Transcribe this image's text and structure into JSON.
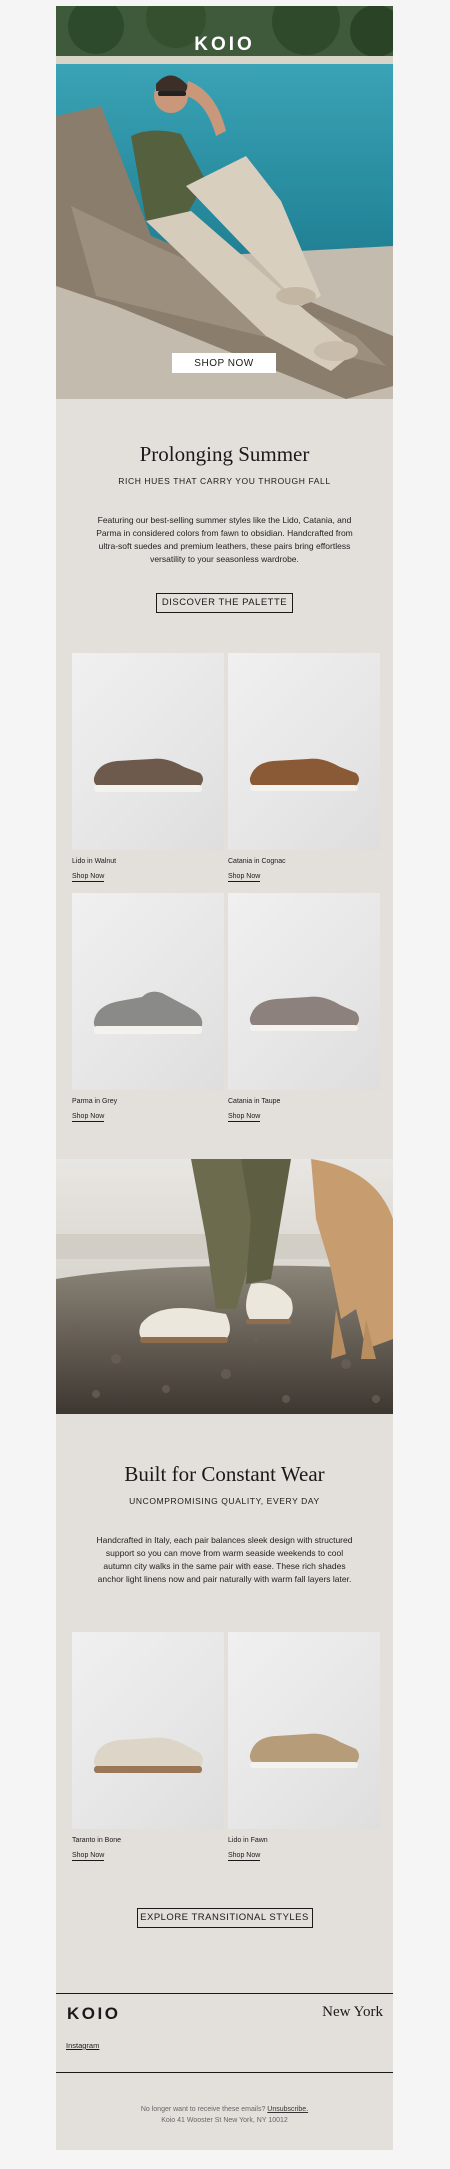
{
  "brand": "KOIO",
  "hero": {
    "cta_label": "SHOP NOW"
  },
  "section1": {
    "title": "Prolonging Summer",
    "subtitle": "RICH HUES THAT CARRY YOU THROUGH FALL",
    "body": "Featuring our best-selling summer styles like the Lido, Catania, and Parma in considered colors from fawn to obsidian. Handcrafted from ultra-soft suedes and premium leathers, these pairs bring effortless versatility to your seasonless wardrobe.",
    "cta_label": "DISCOVER THE PALETTE"
  },
  "products1": [
    {
      "name": "Lido in Walnut",
      "link": "Shop Now",
      "color": "#6e5a4c"
    },
    {
      "name": "Catania in Cognac",
      "link": "Shop Now",
      "color": "#8a5a36"
    },
    {
      "name": "Parma in Grey",
      "link": "Shop Now",
      "color": "#8a8a88"
    },
    {
      "name": "Catania in Taupe",
      "link": "Shop Now",
      "color": "#8c817d"
    }
  ],
  "section2": {
    "title": "Built for Constant Wear",
    "subtitle": "UNCOMPROMISING QUALITY, EVERY DAY",
    "body": "Handcrafted in Italy, each pair balances sleek design with structured support so you can move from warm seaside weekends to cool autumn city walks in the same pair with ease. These rich shades anchor light linens now and pair naturally with warm fall layers later.",
    "cta_label": "EXPLORE TRANSITIONAL STYLES"
  },
  "products2": [
    {
      "name": "Taranto in Bone",
      "link": "Shop Now",
      "color": "#ddd6c8"
    },
    {
      "name": "Lido in Fawn",
      "link": "Shop Now",
      "color": "#b79c7a"
    }
  ],
  "footer": {
    "brand": "KOIO",
    "city": "New York",
    "social": "Instagram",
    "unsubscribe_prefix": "No longer want to receive these emails?",
    "unsubscribe_link": "Unsubscribe.",
    "address": "Koio 41 Wooster St New York, NY 10012"
  }
}
